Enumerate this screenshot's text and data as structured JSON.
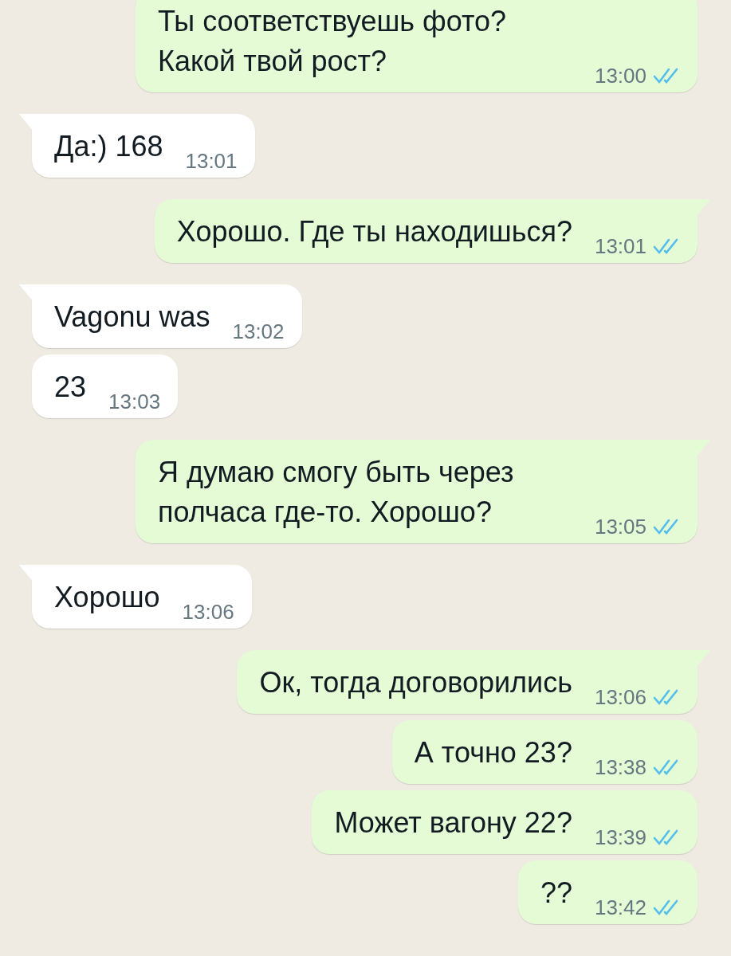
{
  "messages": [
    {
      "kind": "outgoing",
      "text": "Ты соответствуешь фото? Какой твой рост?",
      "time": "13:00",
      "read": true,
      "tail": false
    },
    {
      "kind": "incoming",
      "text": "Да:) 168",
      "time": "13:01",
      "tail": true
    },
    {
      "kind": "outgoing",
      "text": "Хорошо. Где ты находишься?",
      "time": "13:01",
      "read": true,
      "tail": true
    },
    {
      "kind": "incoming",
      "text": "Vagonu was",
      "time": "13:02",
      "tail": true
    },
    {
      "kind": "incoming",
      "text": "23",
      "time": "13:03",
      "tail": false
    },
    {
      "kind": "outgoing",
      "text": "Я думаю смогу быть через полчаса где-то. Хорошо?",
      "time": "13:05",
      "read": true,
      "tail": true
    },
    {
      "kind": "incoming",
      "text": "Хорошо",
      "time": "13:06",
      "tail": true
    },
    {
      "kind": "outgoing",
      "text": "Ок, тогда договорились",
      "time": "13:06",
      "read": true,
      "tail": true
    },
    {
      "kind": "outgoing",
      "text": "А точно 23?",
      "time": "13:38",
      "read": true,
      "tail": false
    },
    {
      "kind": "outgoing",
      "text": "Может вагону 22?",
      "time": "13:39",
      "read": true,
      "tail": false
    },
    {
      "kind": "outgoing",
      "text": "??",
      "time": "13:42",
      "read": true,
      "tail": false
    }
  ]
}
